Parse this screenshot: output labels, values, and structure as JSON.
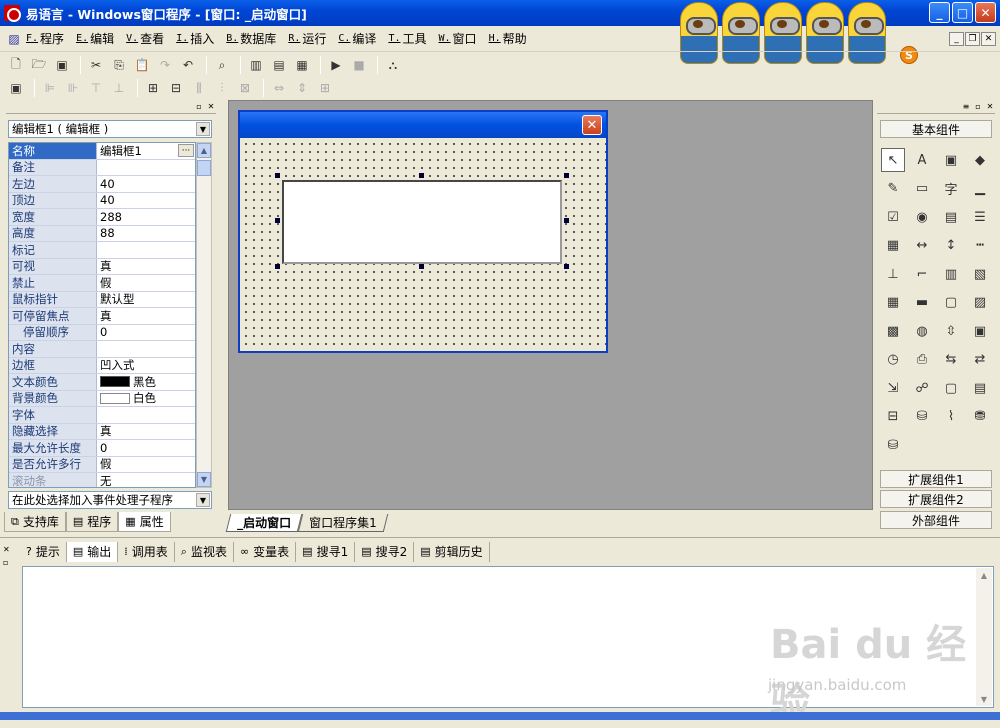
{
  "window": {
    "title": "易语言 - Windows窗口程序 - [窗口: _启动窗口]",
    "min": "_",
    "max": "□",
    "close": "✕"
  },
  "menu": [
    {
      "key": "F.",
      "label": "程序"
    },
    {
      "key": "E.",
      "label": "编辑"
    },
    {
      "key": "V.",
      "label": "查看"
    },
    {
      "key": "I.",
      "label": "插入"
    },
    {
      "key": "B.",
      "label": "数据库"
    },
    {
      "key": "R.",
      "label": "运行"
    },
    {
      "key": "C.",
      "label": "编译"
    },
    {
      "key": "T.",
      "label": "工具"
    },
    {
      "key": "W.",
      "label": "窗口"
    },
    {
      "key": "H.",
      "label": "帮助"
    }
  ],
  "mdi_buttons": [
    "_",
    "❐",
    "✕"
  ],
  "logo": {
    "badge": "S"
  },
  "properties_panel": {
    "object_combo": "编辑框1 ( 编辑框 )",
    "rows": [
      {
        "name": "名称",
        "value": "编辑框1",
        "selected": true
      },
      {
        "name": "备注",
        "value": ""
      },
      {
        "name": "左边",
        "value": "40"
      },
      {
        "name": "顶边",
        "value": "40"
      },
      {
        "name": "宽度",
        "value": "288"
      },
      {
        "name": "高度",
        "value": "88"
      },
      {
        "name": "标记",
        "value": ""
      },
      {
        "name": "可视",
        "value": "真"
      },
      {
        "name": "禁止",
        "value": "假"
      },
      {
        "name": "鼠标指针",
        "value": "默认型"
      },
      {
        "name": "可停留焦点",
        "value": "真"
      },
      {
        "name": "停留顺序",
        "value": "0",
        "indent": true
      },
      {
        "name": "内容",
        "value": ""
      },
      {
        "name": "边框",
        "value": "凹入式"
      },
      {
        "name": "文本颜色",
        "value": "黑色",
        "swatch": "#000000"
      },
      {
        "name": "背景颜色",
        "value": "白色",
        "swatch": "#ffffff"
      },
      {
        "name": "字体",
        "value": ""
      },
      {
        "name": "隐藏选择",
        "value": "真"
      },
      {
        "name": "最大允许长度",
        "value": "0"
      },
      {
        "name": "是否允许多行",
        "value": "假"
      },
      {
        "name": "滚动条",
        "value": "无"
      }
    ],
    "event_combo": "在此处选择加入事件处理子程序",
    "tabs": [
      "支持库",
      "程序",
      "属性"
    ]
  },
  "designer": {
    "tabs": [
      "_启动窗口",
      "窗口程序集1"
    ]
  },
  "components_panel": {
    "basic_label": "基本组件",
    "extended_label_1": "扩展组件1",
    "extended_label_2": "扩展组件2",
    "external_label": "外部组件",
    "tools": [
      {
        "name": "pointer-icon",
        "glyph": "↖"
      },
      {
        "name": "label-icon",
        "glyph": "A"
      },
      {
        "name": "picture-box-icon",
        "glyph": "▣"
      },
      {
        "name": "shape-icon",
        "glyph": "◆"
      },
      {
        "name": "editbox-icon",
        "glyph": "✎"
      },
      {
        "name": "text-image-icon",
        "glyph": "▭"
      },
      {
        "name": "label-char-icon",
        "glyph": "字"
      },
      {
        "name": "button-icon",
        "glyph": "▁"
      },
      {
        "name": "checkbox-icon",
        "glyph": "☑"
      },
      {
        "name": "radio-icon",
        "glyph": "◉"
      },
      {
        "name": "combo-icon",
        "glyph": "▤"
      },
      {
        "name": "listbox-icon",
        "glyph": "☰"
      },
      {
        "name": "listview-icon",
        "glyph": "▦"
      },
      {
        "name": "hscroll-icon",
        "glyph": "↔"
      },
      {
        "name": "vscroll-icon",
        "glyph": "↕"
      },
      {
        "name": "ruler-icon",
        "glyph": "┅"
      },
      {
        "name": "hslider-icon",
        "glyph": "⊥"
      },
      {
        "name": "frame-icon",
        "glyph": "⌐"
      },
      {
        "name": "vprogress-icon",
        "glyph": "▥"
      },
      {
        "name": "tab-icon",
        "glyph": "▧"
      },
      {
        "name": "grid-icon",
        "glyph": "▦"
      },
      {
        "name": "toolbar-icon",
        "glyph": "▬"
      },
      {
        "name": "dir-icon",
        "glyph": "▢"
      },
      {
        "name": "calendar-icon",
        "glyph": "▨"
      },
      {
        "name": "table-icon",
        "glyph": "▩"
      },
      {
        "name": "globe-icon",
        "glyph": "◍"
      },
      {
        "name": "spin-icon",
        "glyph": "⇳"
      },
      {
        "name": "window-icon",
        "glyph": "▣"
      },
      {
        "name": "timer-icon",
        "glyph": "◷"
      },
      {
        "name": "printer-icon",
        "glyph": "⎙"
      },
      {
        "name": "network-icon",
        "glyph": "⇆"
      },
      {
        "name": "network2-icon",
        "glyph": "⇄"
      },
      {
        "name": "client-icon",
        "glyph": "⇲"
      },
      {
        "name": "link-icon",
        "glyph": "☍"
      },
      {
        "name": "form-icon",
        "glyph": "▢"
      },
      {
        "name": "multiform-icon",
        "glyph": "▤"
      },
      {
        "name": "db-table-icon",
        "glyph": "⊟"
      },
      {
        "name": "db-icon",
        "glyph": "⛁"
      },
      {
        "name": "chart-icon",
        "glyph": "⌇"
      },
      {
        "name": "odbc-icon",
        "glyph": "⛃"
      },
      {
        "name": "odbc2-icon",
        "glyph": "⛁"
      }
    ]
  },
  "output_panel": {
    "tabs": [
      "提示",
      "输出",
      "调用表",
      "监视表",
      "变量表",
      "搜寻1",
      "搜寻2",
      "剪辑历史"
    ],
    "tab_icons": [
      "?",
      "▤",
      "⁞",
      "⌕",
      "∞",
      "▤",
      "▤",
      "▤"
    ]
  },
  "watermark": {
    "logo": "Bai du 经验",
    "url": "jingyan.baidu.com"
  }
}
